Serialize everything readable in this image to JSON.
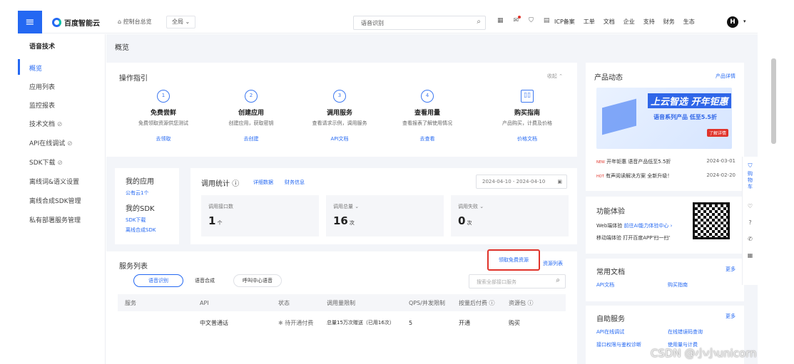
{
  "topbar": {
    "brand": "百度智能云",
    "home_label": "控制台总览",
    "region": "全局",
    "search_value": "语音识别",
    "links": [
      "ICP备案",
      "工单",
      "文档",
      "企业",
      "支持",
      "财务",
      "生态"
    ],
    "avatar_letter": "H"
  },
  "sidebar": {
    "title": "语音技术",
    "items": [
      {
        "label": "概览"
      },
      {
        "label": "应用列表"
      },
      {
        "label": "监控报表"
      },
      {
        "label": "技术文档"
      },
      {
        "label": "API在线调试"
      },
      {
        "label": "SDK下载"
      },
      {
        "label": "离线词&语义设置"
      },
      {
        "label": "离线合成SDK管理"
      },
      {
        "label": "私有部署服务管理"
      }
    ]
  },
  "main": {
    "page_title": "概览",
    "guide": {
      "title": "操作指引",
      "collapse_label": "收起",
      "steps": [
        {
          "num": "1",
          "title": "免费尝鲜",
          "desc": "免费领取资源供您测试",
          "link": "去领取"
        },
        {
          "num": "2",
          "title": "创建应用",
          "desc": "创建应用，获取密钥",
          "link": "去创建"
        },
        {
          "num": "3",
          "title": "调用服务",
          "desc": "查看请求示例，调用服务",
          "link": "API文档"
        },
        {
          "num": "4",
          "title": "查看用量",
          "desc": "查看报表了解使用情况",
          "link": "去查看"
        },
        {
          "num": "",
          "title": "购买指南",
          "desc": "产品购买，计费及价格",
          "link": "价格文档"
        }
      ]
    },
    "my_apps": {
      "title": "我的应用",
      "count_link": "公有云1个",
      "sdk_title": "我的SDK",
      "sdk_link1": "SDK下载",
      "sdk_link2": "离线合成SDK"
    },
    "stats": {
      "title": "调用统计",
      "link1": "详细数据",
      "link2": "财务信息",
      "date_range": "2024-04-10 - 2024-04-10",
      "items": [
        {
          "label": "调用接口数",
          "value": "1",
          "unit": "个"
        },
        {
          "label": "调用总量",
          "value": "16",
          "unit": "次"
        },
        {
          "label": "调用失败",
          "value": "0",
          "unit": "次"
        }
      ]
    },
    "services": {
      "title": "服务列表",
      "claim_label": "领取免费资源",
      "resources_label": "资源列表",
      "tabs": [
        "语音识别",
        "语音合成",
        "呼叫中心语音"
      ],
      "search_placeholder": "搜索全部接口服务",
      "columns": [
        "服务",
        "API",
        "状态",
        "调用量限制",
        "QPS/并发限制",
        "按量后付费",
        "资源包"
      ],
      "rows": [
        {
          "service": "",
          "api": "中文普通话",
          "status": "待开通付费",
          "limit": "总量15万次赠送（已用16次）",
          "qps": "5",
          "postpay": "开通",
          "pack": "购买"
        }
      ]
    }
  },
  "right": {
    "news": {
      "title": "产品动态",
      "link": "产品详情",
      "banner_title": "上云智选 开年钜惠",
      "banner_sub": "语音系列产品 低至5.5折",
      "banner_btn": "了解详情",
      "items": [
        {
          "badge": "NEW",
          "text": "开年钜惠 语音产品低至5.5折",
          "date": "2024-03-01"
        },
        {
          "badge": "HOT",
          "text": "有声阅读解决方案 全新升级！",
          "date": "2024-02-20"
        }
      ]
    },
    "trial": {
      "title": "功能体验",
      "line1_prefix": "Web端体验",
      "line1_link": "前往AI能力体验中心",
      "line2": "移动端体验 打开百度APP'扫一扫'"
    },
    "docs": {
      "title": "常用文档",
      "more": "更多",
      "links": [
        "API文档",
        "购买指南"
      ]
    },
    "selfservice": {
      "title": "自助服务",
      "more": "更多",
      "links": [
        "API在线调试",
        "在线错误码查询",
        "接口权限与鉴权诊断",
        "使用量与计费"
      ]
    }
  },
  "rightnav": {
    "cart_label": "购物车"
  },
  "watermark": "CSDN @小小unicorn",
  "colors": {
    "accent": "#2468f2",
    "highlight_box": "#e0332a"
  }
}
